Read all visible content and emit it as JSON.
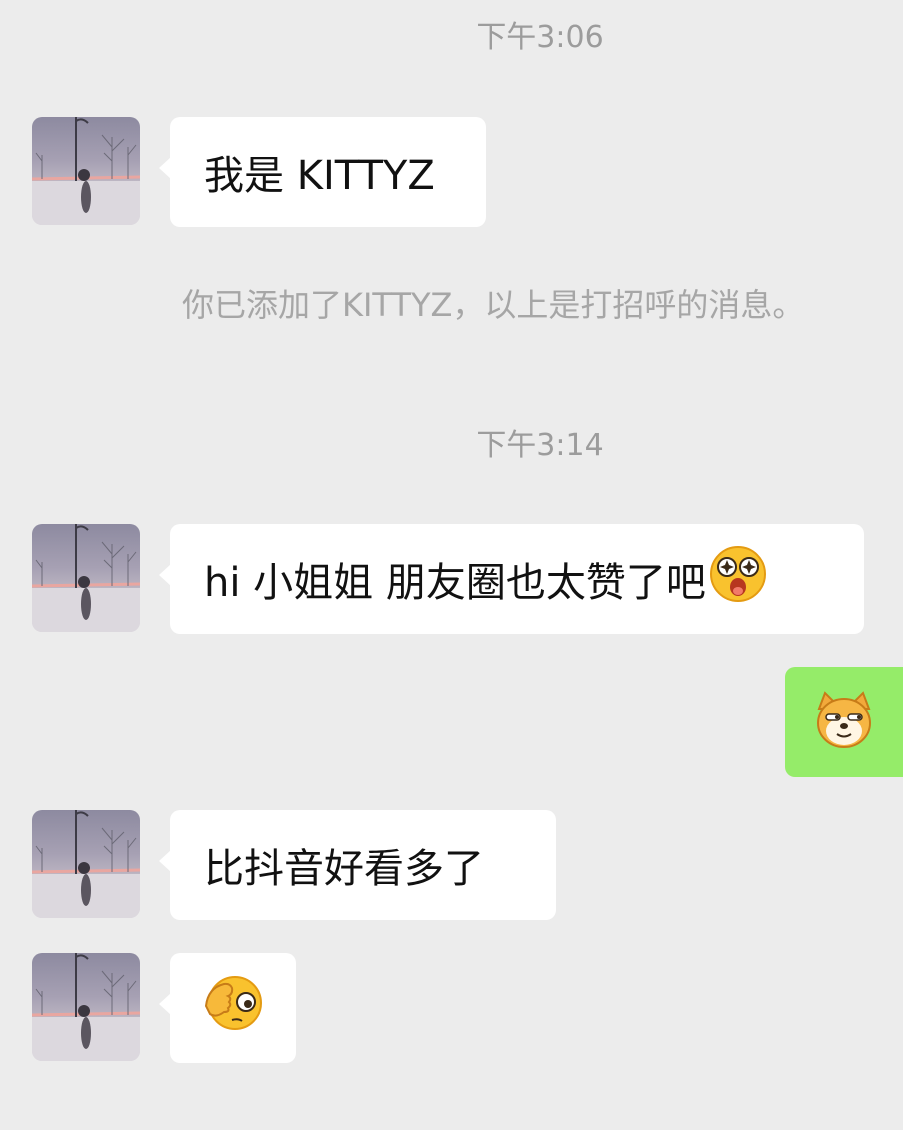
{
  "chat": {
    "timestamps": [
      "下午3:06",
      "下午3:14"
    ],
    "system_notice": "你已添加了KITTYZ，以上是打招呼的消息。",
    "messages": [
      {
        "sender": "contact",
        "text": "我是 KITTYZ"
      },
      {
        "sender": "contact",
        "text": "hi 小姐姐 朋友圈也太赞了吧",
        "emoji": "star-struck-face-icon"
      },
      {
        "sender": "me",
        "emoji": "doge-icon"
      },
      {
        "sender": "contact",
        "text": "比抖音好看多了"
      },
      {
        "sender": "contact",
        "emoji": "facepalm-face-icon"
      }
    ]
  },
  "colors": {
    "background": "#ececec",
    "incoming_bubble": "#ffffff",
    "outgoing_bubble": "#95ec69",
    "timestamp_text": "#9c9c9c"
  }
}
